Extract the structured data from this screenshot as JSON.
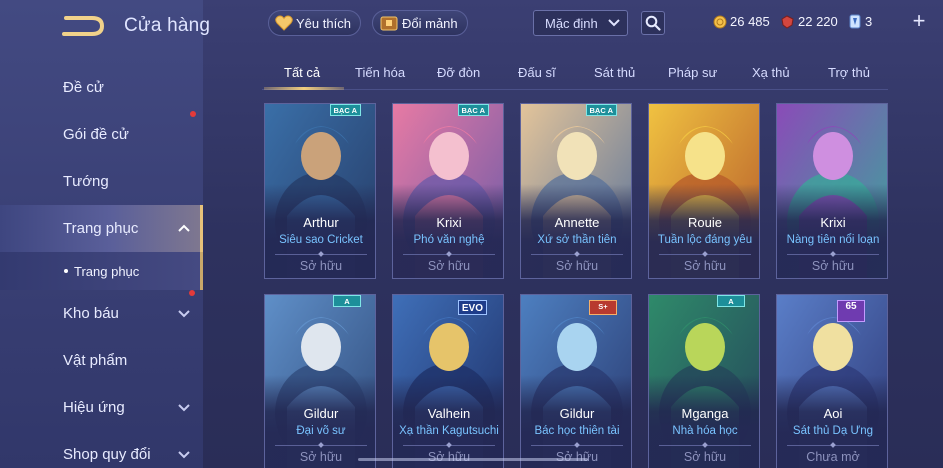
{
  "header": {
    "title": "Cửa hàng",
    "favorite_label": "Yêu thích",
    "exchange_label": "Đổi mảnh",
    "sort_value": "Mặc định",
    "currencies": [
      {
        "icon": "gold-coin-icon",
        "value": "26 485"
      },
      {
        "icon": "ruby-gem-icon",
        "value": "22 220"
      },
      {
        "icon": "ticket-icon",
        "value": "3"
      }
    ],
    "plus_label": "+"
  },
  "sidebar": {
    "items": [
      {
        "label": "Đề cử"
      },
      {
        "label": "Gói đề cử",
        "dot": true
      },
      {
        "label": "Tướng"
      },
      {
        "label": "Trang phục",
        "expanded": true,
        "active": true
      },
      {
        "label": "Kho báu",
        "dot": true
      },
      {
        "label": "Vật phẩm"
      },
      {
        "label": "Hiệu ứng"
      },
      {
        "label": "Shop quy đổi"
      }
    ],
    "subitem": "Trang phục"
  },
  "tabs": [
    "Tất cả",
    "Tiến hóa",
    "Đỡ đòn",
    "Đấu sĩ",
    "Sát thủ",
    "Pháp sư",
    "Xạ thủ",
    "Trợ thủ"
  ],
  "active_tab": "Tất cả",
  "cards": [
    {
      "hero": "Arthur",
      "skin": "Siêu sao Cricket",
      "status": "Sở hữu",
      "badge": "BẠC A",
      "palette": [
        "#3a6fa8",
        "#caa27a",
        "#263b66"
      ]
    },
    {
      "hero": "Krixi",
      "skin": "Phó văn nghệ",
      "status": "Sở hữu",
      "badge": "BẠC A",
      "palette": [
        "#e77aa4",
        "#f4c0cf",
        "#6a5aa8"
      ]
    },
    {
      "hero": "Annette",
      "skin": "Xứ sở thần tiên",
      "status": "Sở hữu",
      "badge": "BẠC A",
      "palette": [
        "#e3c49a",
        "#f1e2b8",
        "#58729a"
      ]
    },
    {
      "hero": "Rouie",
      "skin": "Tuần lộc đáng yêu",
      "status": "Sở hữu",
      "badge": "",
      "palette": [
        "#f0c241",
        "#f6e28a",
        "#b55a2a"
      ]
    },
    {
      "hero": "Krixi",
      "skin": "Nàng tiên nổi loạn",
      "status": "Sở hữu",
      "badge": "",
      "palette": [
        "#8a4bb8",
        "#cf8fe0",
        "#3aa89a"
      ]
    },
    {
      "hero": "Gildur",
      "skin": "Đại võ sư",
      "status": "Sở hữu",
      "badge": "A",
      "palette": [
        "#5f8fc8",
        "#dfe6ee",
        "#2f4a7a"
      ]
    },
    {
      "hero": "Valhein",
      "skin": "Xạ thần Kagutsuchi",
      "status": "Sở hữu",
      "badge": "EVO",
      "palette": [
        "#3f6fb8",
        "#e6c46a",
        "#1e2f66"
      ]
    },
    {
      "hero": "Gildur",
      "skin": "Bác học thiên tài",
      "status": "Sở hữu",
      "badge": "S+",
      "palette": [
        "#4d7fc0",
        "#a9d4f0",
        "#2a3a70"
      ]
    },
    {
      "hero": "Mganga",
      "skin": "Nhà hóa học",
      "status": "Sở hữu",
      "badge": "A",
      "palette": [
        "#2f8a6a",
        "#b9d65a",
        "#24445a"
      ]
    },
    {
      "hero": "Aoi",
      "skin": "Sát thủ Dạ Ưng",
      "status": "Chưa mở",
      "badge": "65",
      "palette": [
        "#5a7ec8",
        "#f0e0a0",
        "#2e3a78"
      ]
    }
  ]
}
